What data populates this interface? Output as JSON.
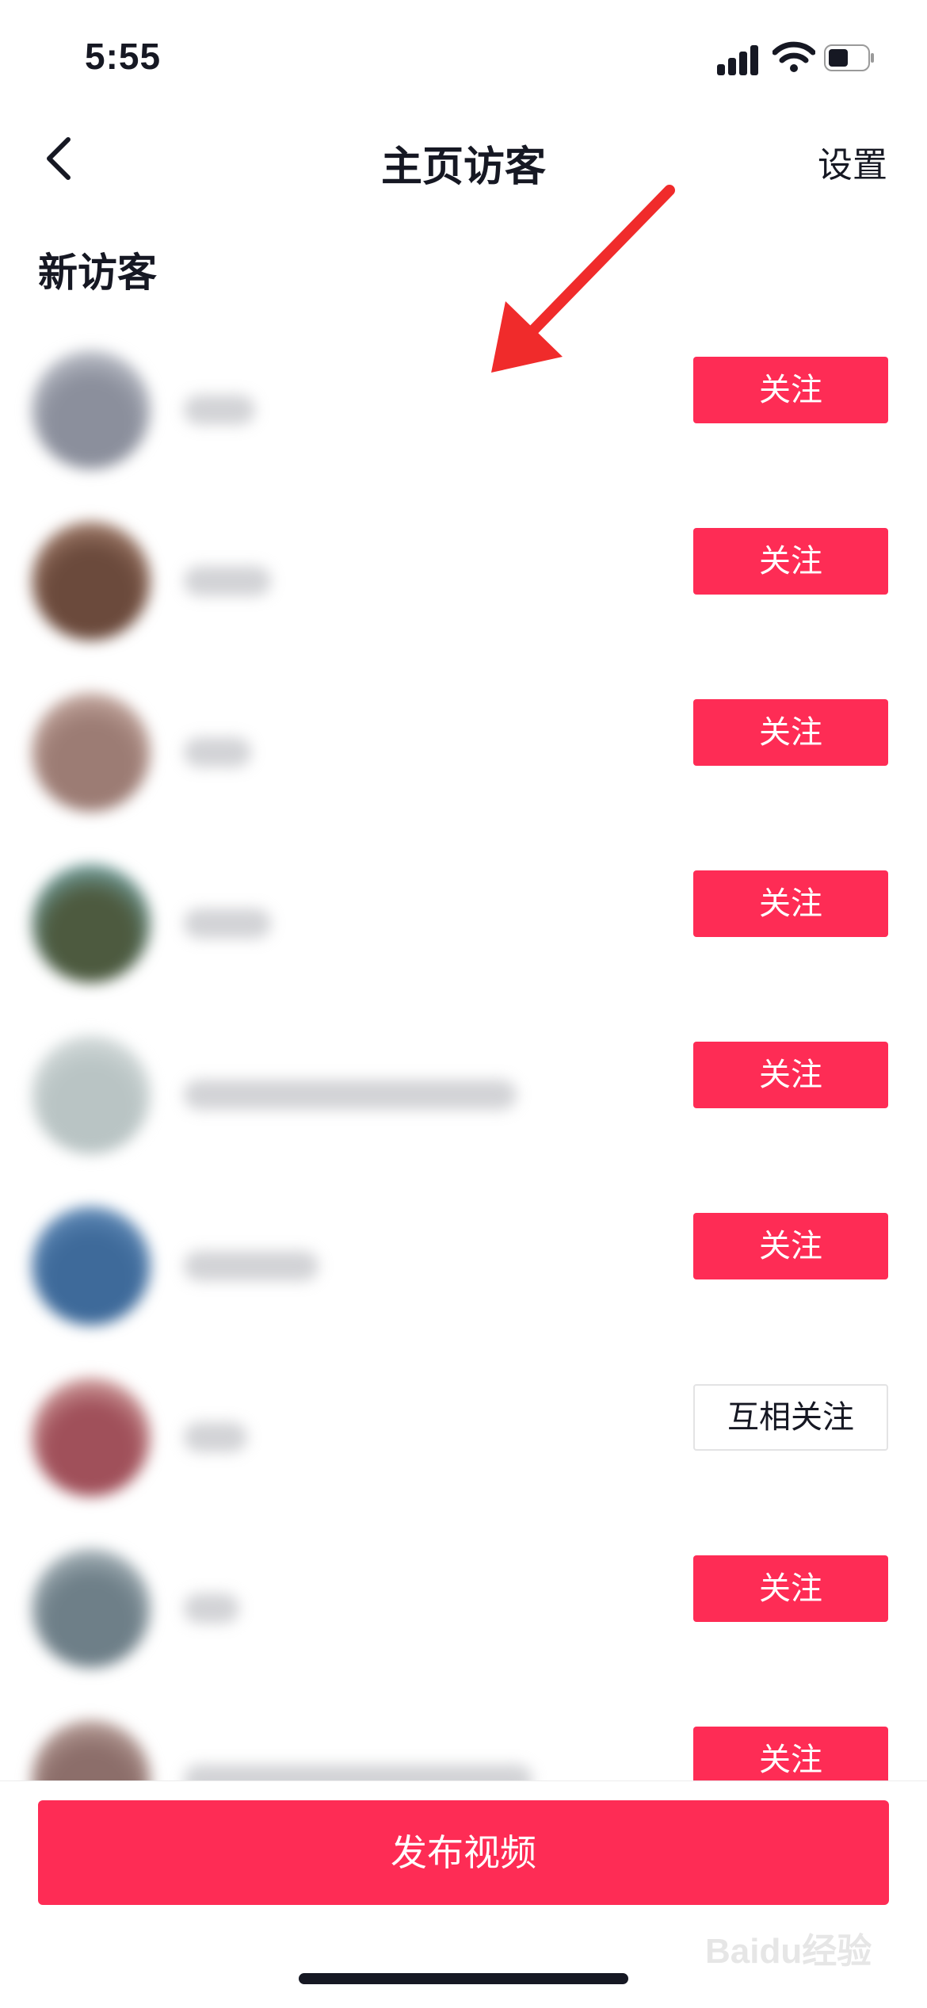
{
  "status_bar": {
    "time": "5:55"
  },
  "nav": {
    "title": "主页访客",
    "settings_label": "设置"
  },
  "section": {
    "title": "新访客"
  },
  "visitors": [
    {
      "button_label": "关注",
      "button_type": "follow",
      "avatar_colors": [
        "#8b8f9c",
        "#dfe2e8"
      ],
      "name_width": 90
    },
    {
      "button_label": "关注",
      "button_type": "follow",
      "avatar_colors": [
        "#6b4a3c",
        "#c9a28e"
      ],
      "name_width": 110
    },
    {
      "button_label": "关注",
      "button_type": "follow",
      "avatar_colors": [
        "#9c7c74",
        "#e2c9c0"
      ],
      "name_width": 85
    },
    {
      "button_label": "关注",
      "button_type": "follow",
      "avatar_colors": [
        "#4d5a3f",
        "#8fd6e8"
      ],
      "name_width": 110
    },
    {
      "button_label": "关注",
      "button_type": "follow",
      "avatar_colors": [
        "#b9c4c4",
        "#e8ecec"
      ],
      "name_width": 420
    },
    {
      "button_label": "关注",
      "button_type": "follow",
      "avatar_colors": [
        "#3e6a9a",
        "#7fa6cf"
      ],
      "name_width": 170
    },
    {
      "button_label": "互相关注",
      "button_type": "mutual",
      "avatar_colors": [
        "#a0505a",
        "#f2d8cf"
      ],
      "name_width": 80
    },
    {
      "button_label": "关注",
      "button_type": "follow",
      "avatar_colors": [
        "#6e7f88",
        "#cfd8dc"
      ],
      "name_width": 70
    },
    {
      "button_label": "关注",
      "button_type": "follow",
      "avatar_colors": [
        "#8c6e6a",
        "#d8c3bc"
      ],
      "name_width": 440
    }
  ],
  "bottom": {
    "publish_label": "发布视频",
    "watermark": "Baidu经验"
  }
}
